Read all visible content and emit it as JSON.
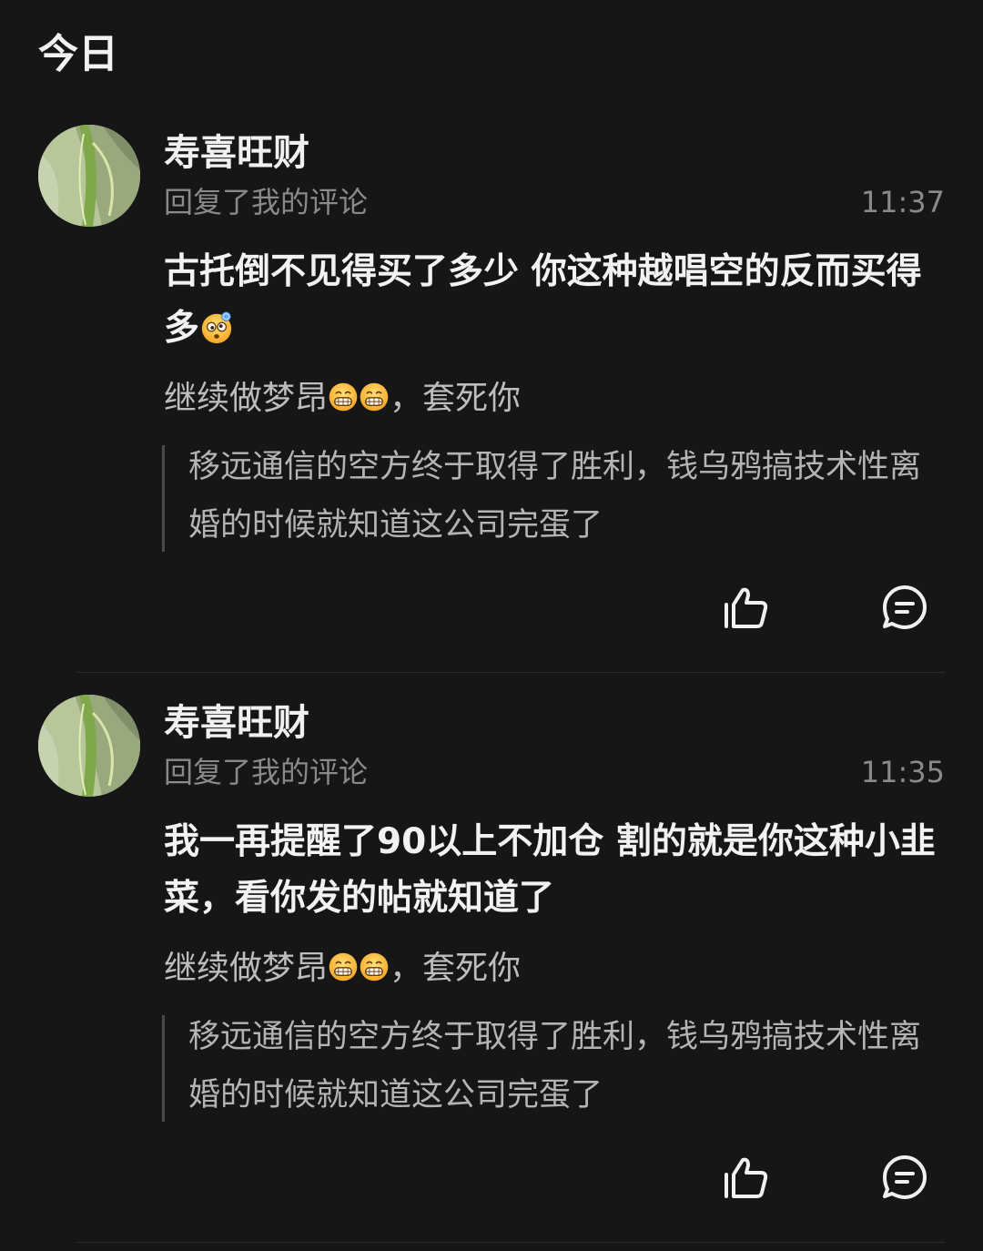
{
  "section": {
    "title": "今日"
  },
  "colors": {
    "background": "#161616",
    "primary_text": "#f2f2f2",
    "secondary_text": "#8a8a8a",
    "quote_bar": "#4a4a4a"
  },
  "notifications": [
    {
      "username": "寿喜旺财",
      "action": "回复了我的评论",
      "time": "11:37",
      "reply_text": "古托倒不见得买了多少 你这种越唱空的反而买得多",
      "reply_emoji": "dizzy-face-emoji",
      "my_comment_prefix": "继续做梦昂",
      "my_comment_emojis": [
        "grinning-face-emoji",
        "grinning-face-emoji"
      ],
      "my_comment_suffix": "，套死你",
      "quoted_post": "移远通信的空方终于取得了胜利，钱乌鸦搞技术性离婚的时候就知道这公司完蛋了",
      "like_icon": "thumbs-up-icon",
      "comment_icon": "comment-bubble-icon"
    },
    {
      "username": "寿喜旺财",
      "action": "回复了我的评论",
      "time": "11:35",
      "reply_text": "我一再提醒了90以上不加仓 割的就是你这种小韭菜，看你发的帖就知道了",
      "my_comment_prefix": "继续做梦昂",
      "my_comment_emojis": [
        "grinning-face-emoji",
        "grinning-face-emoji"
      ],
      "my_comment_suffix": "，套死你",
      "quoted_post": "移远通信的空方终于取得了胜利，钱乌鸦搞技术性离婚的时候就知道这公司完蛋了",
      "like_icon": "thumbs-up-icon",
      "comment_icon": "comment-bubble-icon"
    }
  ]
}
